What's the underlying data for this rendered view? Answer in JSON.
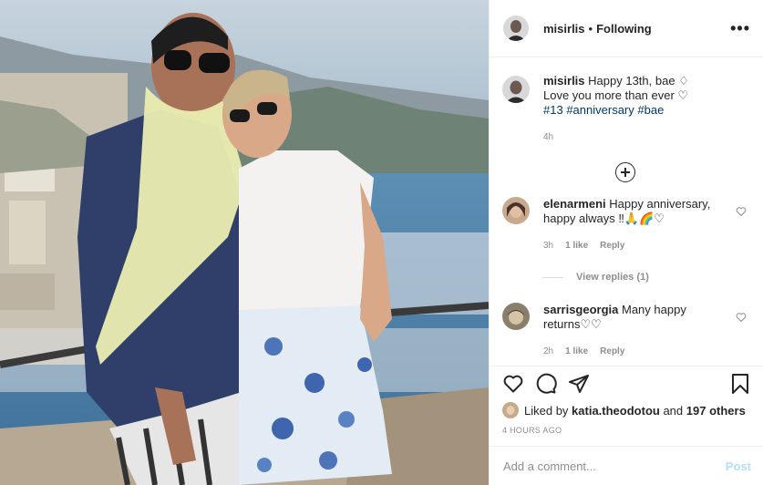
{
  "header": {
    "username": "misirlis",
    "separator": "•",
    "follow_status": "Following",
    "more_label": "•••"
  },
  "caption": {
    "username": "misirlis",
    "line1": "Happy 13th, bae ♢",
    "line2": "Love you more than ever ♡",
    "hashtags": [
      "#13",
      "#anniversary",
      "#bae"
    ],
    "time": "4h"
  },
  "comments": [
    {
      "username": "elenarmeni",
      "text": "Happy anniversary, happy always ‼🙏🌈♡",
      "time": "3h",
      "likes": "1 like",
      "reply": "Reply"
    },
    {
      "username": "sarrisgeorgia",
      "text": "Many happy returns♡♡",
      "time": "2h",
      "likes": "1 like",
      "reply": "Reply"
    }
  ],
  "view_replies": "View replies (1)",
  "likes": {
    "prefix": "Liked by",
    "user": "katia.theodotou",
    "and": "and",
    "others": "197 others"
  },
  "posted_ago": "4 HOURS AGO",
  "add_comment": {
    "placeholder": "Add a comment...",
    "post_label": "Post"
  },
  "colors": {
    "link": "#00376b",
    "muted": "#8e8e8e",
    "post_disabled": "#b2dffc",
    "border": "#efefef"
  }
}
